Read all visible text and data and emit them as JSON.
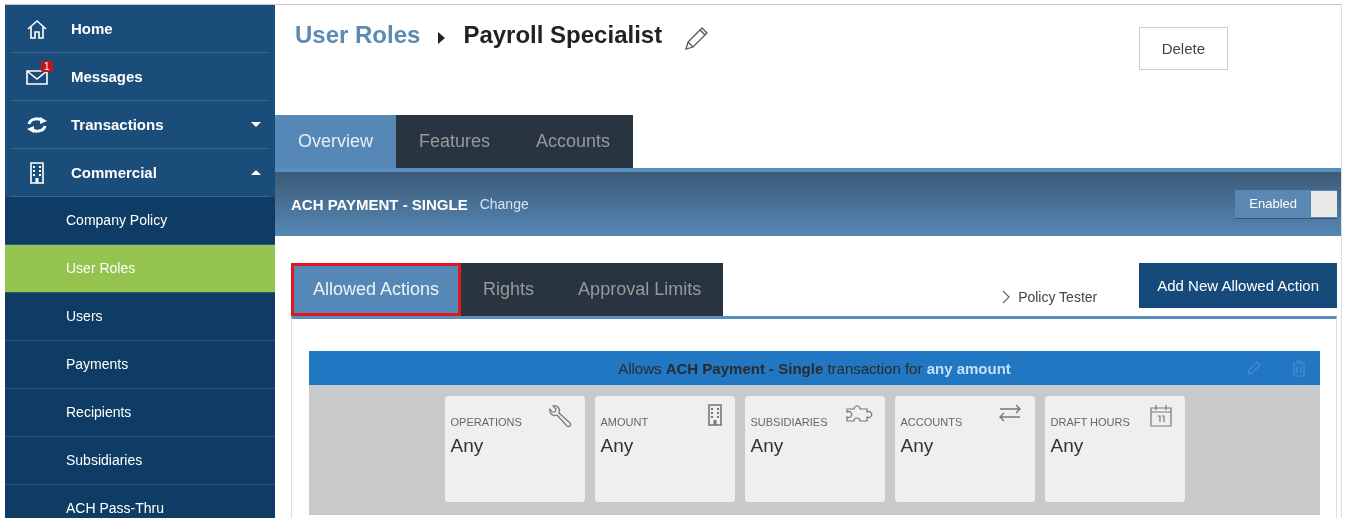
{
  "sidebar": {
    "items": [
      {
        "label": "Home"
      },
      {
        "label": "Messages",
        "badge": "1"
      },
      {
        "label": "Transactions",
        "expanded": false
      },
      {
        "label": "Commercial",
        "expanded": true,
        "children": [
          {
            "label": "Company Policy",
            "selected": false
          },
          {
            "label": "User Roles",
            "selected": true
          },
          {
            "label": "Users",
            "selected": false
          },
          {
            "label": "Payments",
            "selected": false
          },
          {
            "label": "Recipients",
            "selected": false
          },
          {
            "label": "Subsidiaries",
            "selected": false
          },
          {
            "label": "ACH Pass-Thru",
            "selected": false
          }
        ]
      }
    ]
  },
  "breadcrumb": {
    "parent": "User Roles",
    "current": "Payroll Specialist"
  },
  "delete_button": "Delete",
  "tabs": [
    {
      "label": "Overview",
      "selected": true
    },
    {
      "label": "Features",
      "selected": false
    },
    {
      "label": "Accounts",
      "selected": false
    }
  ],
  "feature_bar": {
    "title": "ACH PAYMENT - SINGLE",
    "change_link": "Change",
    "toggle": {
      "label": "Enabled",
      "on": true
    }
  },
  "sub_tabs": [
    {
      "label": "Allowed Actions",
      "selected": true
    },
    {
      "label": "Rights",
      "selected": false
    },
    {
      "label": "Approval Limits",
      "selected": false
    }
  ],
  "policy_tester": "Policy Tester",
  "add_button": "Add New Allowed Action",
  "action": {
    "summary": "Allows **ACH Payment - Single** transaction for",
    "amount_link": "any amount",
    "cards": [
      {
        "label": "OPERATIONS",
        "value": "Any"
      },
      {
        "label": "AMOUNT",
        "value": "Any"
      },
      {
        "label": "SUBSIDIARIES",
        "value": "Any"
      },
      {
        "label": "ACCOUNTS",
        "value": "Any"
      },
      {
        "label": "DRAFT HOURS",
        "value": "Any"
      }
    ]
  }
}
